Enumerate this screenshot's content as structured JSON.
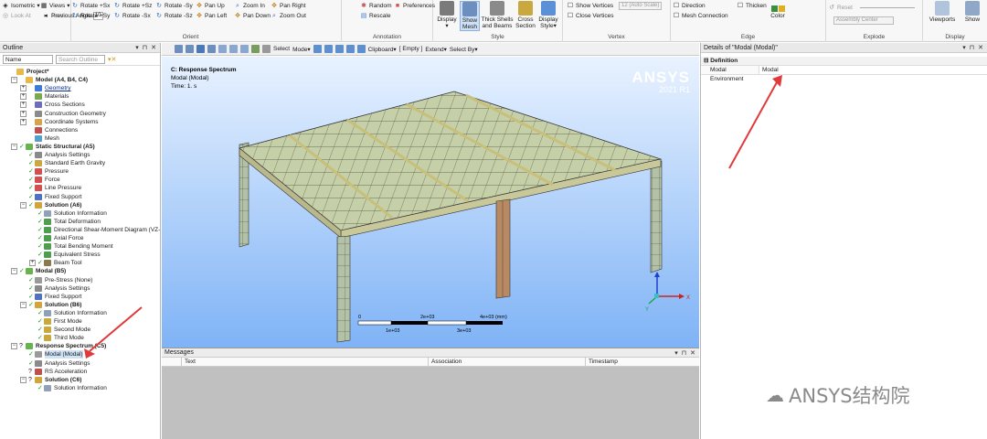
{
  "ribbon": {
    "left_group": {
      "items": [
        {
          "label": "Isometric",
          "icon": "isometric-icon",
          "disabled": false
        },
        {
          "label": "Views",
          "icon": "views-icon",
          "disabled": false
        },
        {
          "label": "Next",
          "icon": "next-icon",
          "disabled": true
        },
        {
          "label": "Look At",
          "icon": "look-at-icon",
          "disabled": true
        },
        {
          "label": "Previous",
          "icon": "previous-icon",
          "disabled": false
        },
        {
          "label": "Angle",
          "icon": "",
          "disabled": false
        }
      ],
      "angle_value": "10"
    },
    "orient": {
      "caption": "Orient",
      "rows": [
        [
          "Rotate +Sx",
          "Rotate +Sz",
          "Rotate -Sy",
          "Pan Up",
          "Zoom In",
          "Pan Right"
        ],
        [
          "Rotate +Sy",
          "Rotate -Sx",
          "Rotate -Sz",
          "Pan Left",
          "Pan Down",
          "Zoom Out"
        ]
      ]
    },
    "annotation": {
      "caption": "Annotation",
      "items": [
        "Random",
        "Preferences",
        "Rescale"
      ]
    },
    "style": {
      "caption": "Style",
      "buttons": [
        {
          "label": "Display",
          "sub": "▾"
        },
        {
          "label": "Show Mesh",
          "sub": ""
        },
        {
          "label": "Thick Shells and Beams",
          "sub": ""
        },
        {
          "label": "Cross Section",
          "sub": ""
        },
        {
          "label": "Display Style",
          "sub": "▾"
        }
      ]
    },
    "vertex": {
      "caption": "Vertex",
      "items": [
        "Show Vertices",
        "Close Vertices"
      ],
      "combo": "12 (Auto Scale)"
    },
    "edge": {
      "caption": "Edge",
      "items": [
        "Direction",
        "Mesh Connection",
        "Thicken"
      ],
      "color_label": "Color"
    },
    "explode": {
      "caption": "Explode",
      "reset": "Reset",
      "combo": "Assembly Center"
    },
    "display": {
      "caption": "Display",
      "viewports": "Viewports",
      "show": "Show"
    }
  },
  "outline": {
    "title": "Outline",
    "filter_name": "Name",
    "search_placeholder": "Search Outline",
    "nodes": [
      {
        "label": "Project*",
        "lvl": 0,
        "tgl": "",
        "status": "",
        "icon": "#e8b84a",
        "bold": true
      },
      {
        "label": "Model (A4, B4, C4)",
        "lvl": 1,
        "tgl": "−",
        "status": "",
        "icon": "#e8b84a",
        "bold": true
      },
      {
        "label": "Geometry",
        "lvl": 2,
        "tgl": "+",
        "status": "",
        "icon": "#3f7bd6",
        "under": true
      },
      {
        "label": "Materials",
        "lvl": 2,
        "tgl": "+",
        "status": "",
        "icon": "#7aa84e"
      },
      {
        "label": "Cross Sections",
        "lvl": 2,
        "tgl": "+",
        "status": "",
        "icon": "#6d6dbd"
      },
      {
        "label": "Construction Geometry",
        "lvl": 2,
        "tgl": "+",
        "status": "",
        "icon": "#8a8a8a"
      },
      {
        "label": "Coordinate Systems",
        "lvl": 2,
        "tgl": "+",
        "status": "",
        "icon": "#d6a44a"
      },
      {
        "label": "Connections",
        "lvl": 2,
        "tgl": "",
        "status": "",
        "icon": "#c05050"
      },
      {
        "label": "Mesh",
        "lvl": 2,
        "tgl": "",
        "status": "",
        "icon": "#55a0c8"
      },
      {
        "label": "Static Structural (A5)",
        "lvl": 1,
        "tgl": "−",
        "status": "✓",
        "icon": "#66b34f",
        "bold": true
      },
      {
        "label": "Analysis Settings",
        "lvl": 2,
        "tgl": "",
        "status": "✓",
        "icon": "#8a8a8a"
      },
      {
        "label": "Standard Earth Gravity",
        "lvl": 2,
        "tgl": "",
        "status": "✓",
        "icon": "#c9a83e"
      },
      {
        "label": "Pressure",
        "lvl": 2,
        "tgl": "",
        "status": "✓",
        "icon": "#d45050"
      },
      {
        "label": "Force",
        "lvl": 2,
        "tgl": "",
        "status": "✓",
        "icon": "#d45050"
      },
      {
        "label": "Line Pressure",
        "lvl": 2,
        "tgl": "",
        "status": "✓",
        "icon": "#d45050"
      },
      {
        "label": "Fixed Support",
        "lvl": 2,
        "tgl": "",
        "status": "✓",
        "icon": "#5070c0"
      },
      {
        "label": "Solution (A6)",
        "lvl": 2,
        "tgl": "−",
        "status": "✓",
        "icon": "#d2a43c",
        "bold": true
      },
      {
        "label": "Solution Information",
        "lvl": 3,
        "tgl": "",
        "status": "✓",
        "icon": "#8fa0b8"
      },
      {
        "label": "Total Deformation",
        "lvl": 3,
        "tgl": "",
        "status": "✓",
        "icon": "#4f9e4f"
      },
      {
        "label": "Directional Shear-Moment Diagram (VZ-",
        "lvl": 3,
        "tgl": "",
        "status": "✓",
        "icon": "#4f9e4f"
      },
      {
        "label": "Axial Force",
        "lvl": 3,
        "tgl": "",
        "status": "✓",
        "icon": "#4f9e4f"
      },
      {
        "label": "Total Bending Moment",
        "lvl": 3,
        "tgl": "",
        "status": "✓",
        "icon": "#4f9e4f"
      },
      {
        "label": "Equivalent Stress",
        "lvl": 3,
        "tgl": "",
        "status": "✓",
        "icon": "#4f9e4f"
      },
      {
        "label": "Beam Tool",
        "lvl": 3,
        "tgl": "+",
        "status": "✓",
        "icon": "#8a7a4e"
      },
      {
        "label": "Modal (B5)",
        "lvl": 1,
        "tgl": "−",
        "status": "✓",
        "icon": "#66b34f",
        "bold": true
      },
      {
        "label": "Pre-Stress (None)",
        "lvl": 2,
        "tgl": "",
        "status": "✓",
        "icon": "#9a9a9a"
      },
      {
        "label": "Analysis Settings",
        "lvl": 2,
        "tgl": "",
        "status": "✓",
        "icon": "#8a8a8a"
      },
      {
        "label": "Fixed Support",
        "lvl": 2,
        "tgl": "",
        "status": "✓",
        "icon": "#5070c0"
      },
      {
        "label": "Solution (B6)",
        "lvl": 2,
        "tgl": "−",
        "status": "✓",
        "icon": "#d2a43c",
        "bold": true
      },
      {
        "label": "Solution Information",
        "lvl": 3,
        "tgl": "",
        "status": "✓",
        "icon": "#8fa0b8"
      },
      {
        "label": "First Mode",
        "lvl": 3,
        "tgl": "",
        "status": "✓",
        "icon": "#c9a83e"
      },
      {
        "label": "Second Mode",
        "lvl": 3,
        "tgl": "",
        "status": "✓",
        "icon": "#c9a83e"
      },
      {
        "label": "Third Mode",
        "lvl": 3,
        "tgl": "",
        "status": "✓",
        "icon": "#c9a83e"
      },
      {
        "label": "Response Spectrum (C5)",
        "lvl": 1,
        "tgl": "−",
        "status": "?",
        "icon": "#66b34f",
        "bold": true
      },
      {
        "label": "Modal (Modal)",
        "lvl": 2,
        "tgl": "",
        "status": "✓",
        "icon": "#9a9a9a",
        "hl": true
      },
      {
        "label": "Analysis Settings",
        "lvl": 2,
        "tgl": "",
        "status": "✓",
        "icon": "#8a8a8a"
      },
      {
        "label": "RS Acceleration",
        "lvl": 2,
        "tgl": "",
        "status": "?",
        "icon": "#c05050"
      },
      {
        "label": "Solution (C6)",
        "lvl": 2,
        "tgl": "−",
        "status": "?",
        "icon": "#d2a43c",
        "bold": true
      },
      {
        "label": "Solution Information",
        "lvl": 3,
        "tgl": "",
        "status": "✓",
        "icon": "#8fa0b8"
      }
    ]
  },
  "viewtoolbar": {
    "select_label": "Select",
    "mode_label": "Mode▾",
    "clipboard_label": "Clipboard▾",
    "empty_label": "[ Empty ]",
    "extend_label": "Extend▾",
    "selectby_label": "Select By▾"
  },
  "viewport": {
    "title": "C: Response Spectrum",
    "line2": "Modal (Modal)",
    "line3": "Time: 1. s",
    "brand": "ANSYS",
    "version": "2021 R1",
    "scale_top": [
      "0",
      "2e+03",
      "4e+03 (mm)"
    ],
    "scale_bottom": [
      "1e+03",
      "3e+03"
    ],
    "axis": {
      "x": "X",
      "y": "Y",
      "z": "Z"
    }
  },
  "messages": {
    "title": "Messages",
    "columns": [
      "Text",
      "Association",
      "Timestamp"
    ]
  },
  "details": {
    "title": "Details of \"Modal (Modal)\"",
    "group": "Definition",
    "rows": [
      {
        "key": "Modal Environment",
        "value": "Modal"
      }
    ]
  },
  "watermark": "ANSYS结构院",
  "colors": {
    "arrow": "#e03a3a",
    "accent": "#3c7fd6"
  }
}
